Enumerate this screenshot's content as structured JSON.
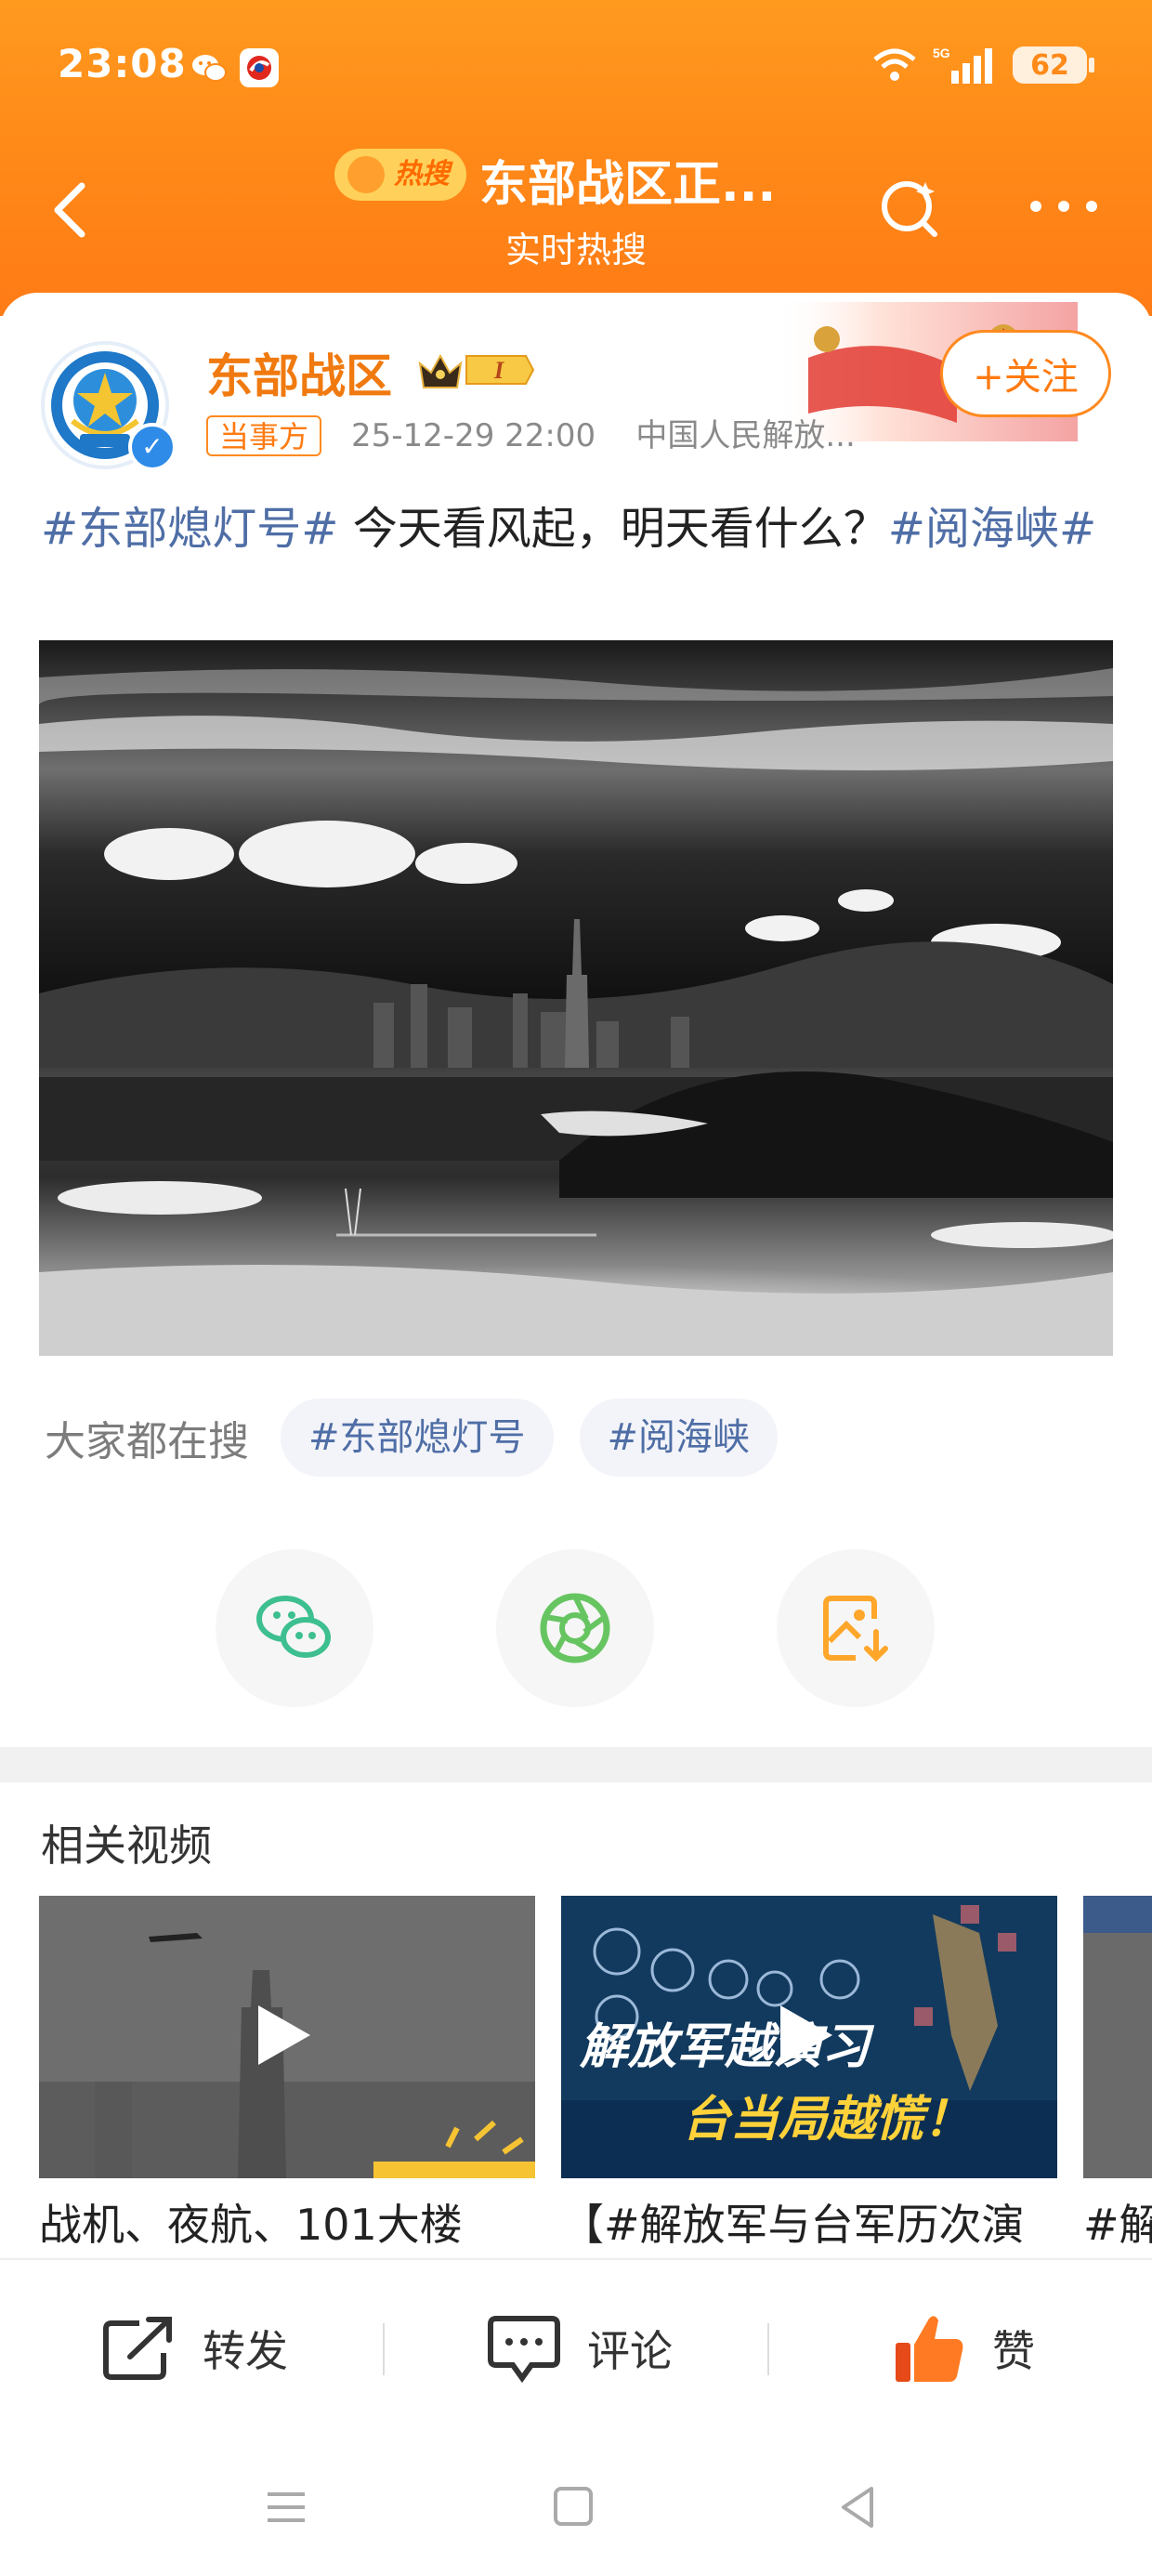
{
  "status_bar": {
    "time": "23:08",
    "network": "5G",
    "battery": "62"
  },
  "nav": {
    "hot_badge": "热搜",
    "title": "东部战区正...",
    "subtitle": "实时热搜"
  },
  "post": {
    "author": "东部战区",
    "author_level": "I",
    "follow_label": "+关注",
    "badge": "当事方",
    "timestamp": "25-12-29 22:00",
    "source": "中国人民解放...",
    "text_topic1": "#东部熄灯号#",
    "text_body": " 今天看风起，明天看什么？",
    "text_topic2": "#阅海峡#"
  },
  "searching": {
    "label": "大家都在搜",
    "tags": [
      "#东部熄灯号",
      "#阅海峡"
    ]
  },
  "share": {
    "items": [
      "wechat-icon",
      "moments-icon",
      "save-image-icon"
    ]
  },
  "related": {
    "title": "相关视频",
    "videos": [
      {
        "caption": "战机、夜航、101大楼"
      },
      {
        "caption": "【#解放军与台军历次演",
        "overlay_line1": "解放军越演习",
        "overlay_line2": "台当局越慌！"
      },
      {
        "caption": "#解"
      }
    ]
  },
  "actions": {
    "repost": "转发",
    "comment": "评论",
    "like": "赞"
  },
  "colors": {
    "header": "#ff8a18",
    "accent": "#f07a10",
    "topic": "#4f6ea6"
  }
}
